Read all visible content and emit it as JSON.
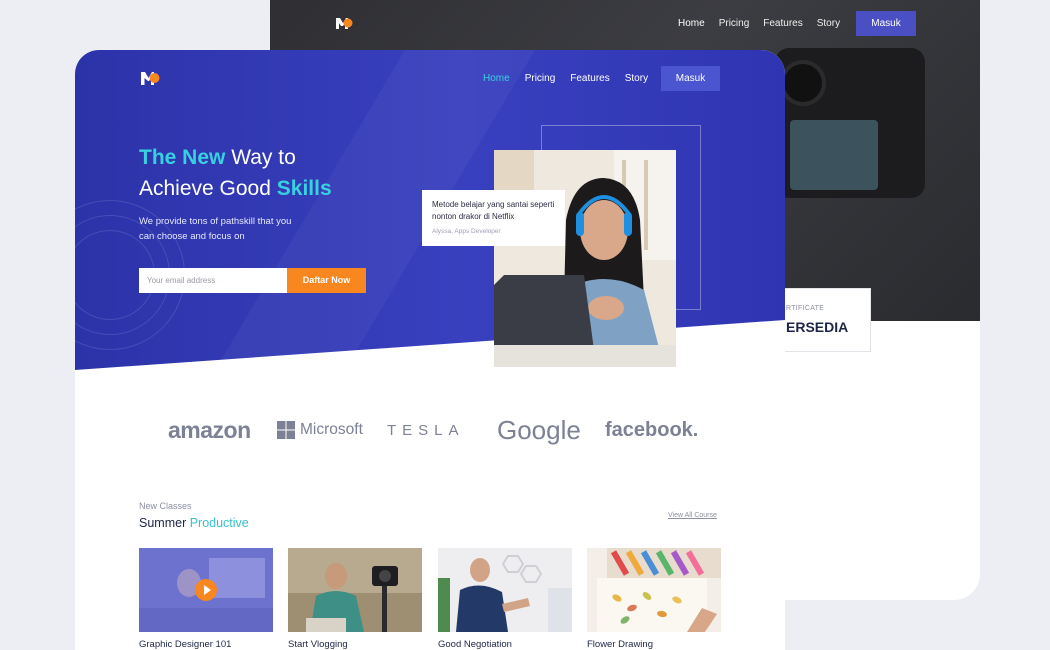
{
  "back_page": {
    "nav": {
      "items": [
        "Home",
        "Pricing",
        "Features",
        "Story"
      ],
      "cta": "Masuk"
    },
    "certificate": {
      "small": "RTIFICATE",
      "big": "ERSEDIA"
    }
  },
  "nav": {
    "items": [
      "Home",
      "Pricing",
      "Features",
      "Story"
    ],
    "active": "Home",
    "cta": "Masuk"
  },
  "hero": {
    "headline_line1_highlight": "The New",
    "headline_line1_rest": " Way to",
    "headline_line2_rest": "Achieve Good ",
    "headline_line2_highlight": "Skills",
    "subtext": "We provide tons of pathskill that you can choose and focus on",
    "email_placeholder": "Your email address",
    "cta": "Daftar Now"
  },
  "testimonial": {
    "quote": "Metode belajar yang santai seperti nonton drakor di Netflix",
    "author": "Alyssa, Apps Developer"
  },
  "partners": [
    "amazon",
    "Microsoft",
    "TESLA",
    "Google",
    "facebook."
  ],
  "classes": {
    "label": "New Classes",
    "title_plain": "Summer ",
    "title_highlight": "Productive",
    "view_all": "View All Course",
    "courses": [
      {
        "title": "Graphic Designer 101"
      },
      {
        "title": "Start Vlogging"
      },
      {
        "title": "Good Negotiation"
      },
      {
        "title": "Flower Drawing"
      }
    ]
  },
  "colors": {
    "hero_blue": "#3136b8",
    "accent_cyan": "#39d0e0",
    "cta_orange": "#f7871e",
    "nav_button": "#4a55cf",
    "text_dark": "#1e2546"
  }
}
